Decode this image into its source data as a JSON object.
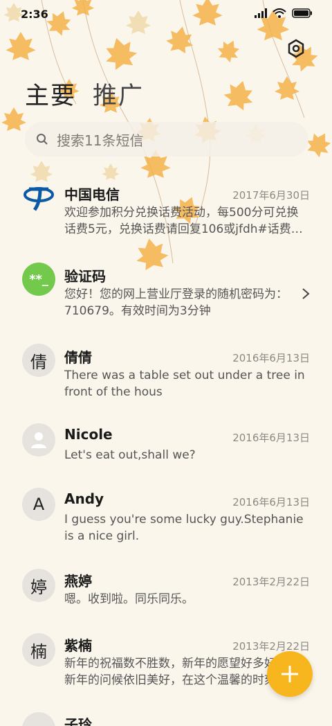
{
  "status": {
    "time": "2:36"
  },
  "tabs": [
    {
      "label": "主要",
      "active": true
    },
    {
      "label": "推广",
      "active": false
    }
  ],
  "search": {
    "placeholder": "搜索11条短信"
  },
  "colors": {
    "accent": "#f7b51e",
    "verify_avatar": "#72c94c",
    "telecom_blue": "#0b5aa6"
  },
  "messages": [
    {
      "name": "中国电信",
      "date": "2017年6月30日",
      "preview": "欢迎参加积分兑换话费活动，每500分可兑换话费5元，兑换话费请回复106或jfdh#话费…",
      "avatar": "china-telecom-logo"
    },
    {
      "name": "验证码",
      "date": "",
      "preview": "您好！您的网上营业厅登录的随机密码为：710679。有效时间为3分钟",
      "avatar_text": "**_"
    },
    {
      "name": "倩倩",
      "date": "2016年6月13日",
      "preview": "There was a table set out under a tree in front of the hous",
      "avatar_text": "倩"
    },
    {
      "name": "Nicole",
      "date": "2016年6月13日",
      "preview": "Let's eat out,shall we?",
      "avatar": "person-icon"
    },
    {
      "name": "Andy",
      "date": "2016年6月13日",
      "preview": "I guess you're some lucky guy.Stephanie is a nice girl.",
      "avatar_text": "A"
    },
    {
      "name": "燕婷",
      "date": "2013年2月22日",
      "preview": "嗯。收到啦。同乐同乐。",
      "avatar_text": "婷"
    },
    {
      "name": "紫楠",
      "date": "2013年2月22日",
      "preview": "新年的祝福数不胜数，新年的愿望好多好多，新年的问候依旧美好，在这个温馨的时刻",
      "avatar_text": "楠"
    },
    {
      "name": "子玲",
      "date": "",
      "preview": "",
      "avatar_text": ""
    }
  ]
}
